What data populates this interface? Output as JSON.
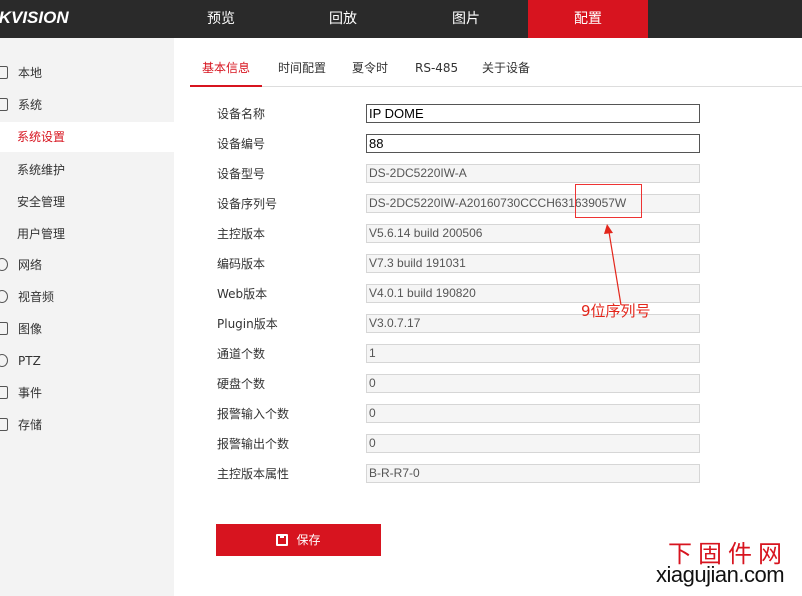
{
  "brand": {
    "logo": "IKVISION"
  },
  "nav": {
    "items": [
      {
        "label": "预览"
      },
      {
        "label": "回放"
      },
      {
        "label": "图片"
      },
      {
        "label": "配置"
      }
    ]
  },
  "sidebar": {
    "items": [
      {
        "label": "本地",
        "icon": "monitor-icon"
      },
      {
        "label": "系统",
        "icon": "system-icon"
      },
      {
        "label": "系统设置"
      },
      {
        "label": "系统维护"
      },
      {
        "label": "安全管理"
      },
      {
        "label": "用户管理"
      },
      {
        "label": "网络",
        "icon": "network-icon"
      },
      {
        "label": "视音频",
        "icon": "video-audio-icon"
      },
      {
        "label": "图像",
        "icon": "image-icon"
      },
      {
        "label": "PTZ",
        "icon": "ptz-icon"
      },
      {
        "label": "事件",
        "icon": "event-icon"
      },
      {
        "label": "存储",
        "icon": "storage-icon"
      }
    ]
  },
  "tabs": [
    {
      "label": "基本信息"
    },
    {
      "label": "时间配置"
    },
    {
      "label": "夏令时"
    },
    {
      "label": "RS-485"
    },
    {
      "label": "关于设备"
    }
  ],
  "form": {
    "rows": [
      {
        "label": "设备名称",
        "value": "IP DOME"
      },
      {
        "label": "设备编号",
        "value": "88"
      },
      {
        "label": "设备型号",
        "value": "DS-2DC5220IW-A"
      },
      {
        "label": "设备序列号",
        "value": "DS-2DC5220IW-A20160730CCCH631639057W"
      },
      {
        "label": "主控版本",
        "value": "V5.6.14 build 200506"
      },
      {
        "label": "编码版本",
        "value": "V7.3 build 191031"
      },
      {
        "label": "Web版本",
        "value": "V4.0.1 build 190820"
      },
      {
        "label": "Plugin版本",
        "value": "V3.0.7.17"
      },
      {
        "label": "通道个数",
        "value": "1"
      },
      {
        "label": "硬盘个数",
        "value": "0"
      },
      {
        "label": "报警输入个数",
        "value": "0"
      },
      {
        "label": "报警输出个数",
        "value": "0"
      },
      {
        "label": "主控版本属性",
        "value": "B-R-R7-0"
      }
    ]
  },
  "save": {
    "label": "保存"
  },
  "annotation": {
    "text": "9位序列号"
  },
  "watermark": {
    "cn": "下固件网",
    "en": "xiagujian.com"
  },
  "colors": {
    "accent": "#d7141f",
    "topbar": "#2a2a2a",
    "sidebar": "#f3f3f3"
  }
}
